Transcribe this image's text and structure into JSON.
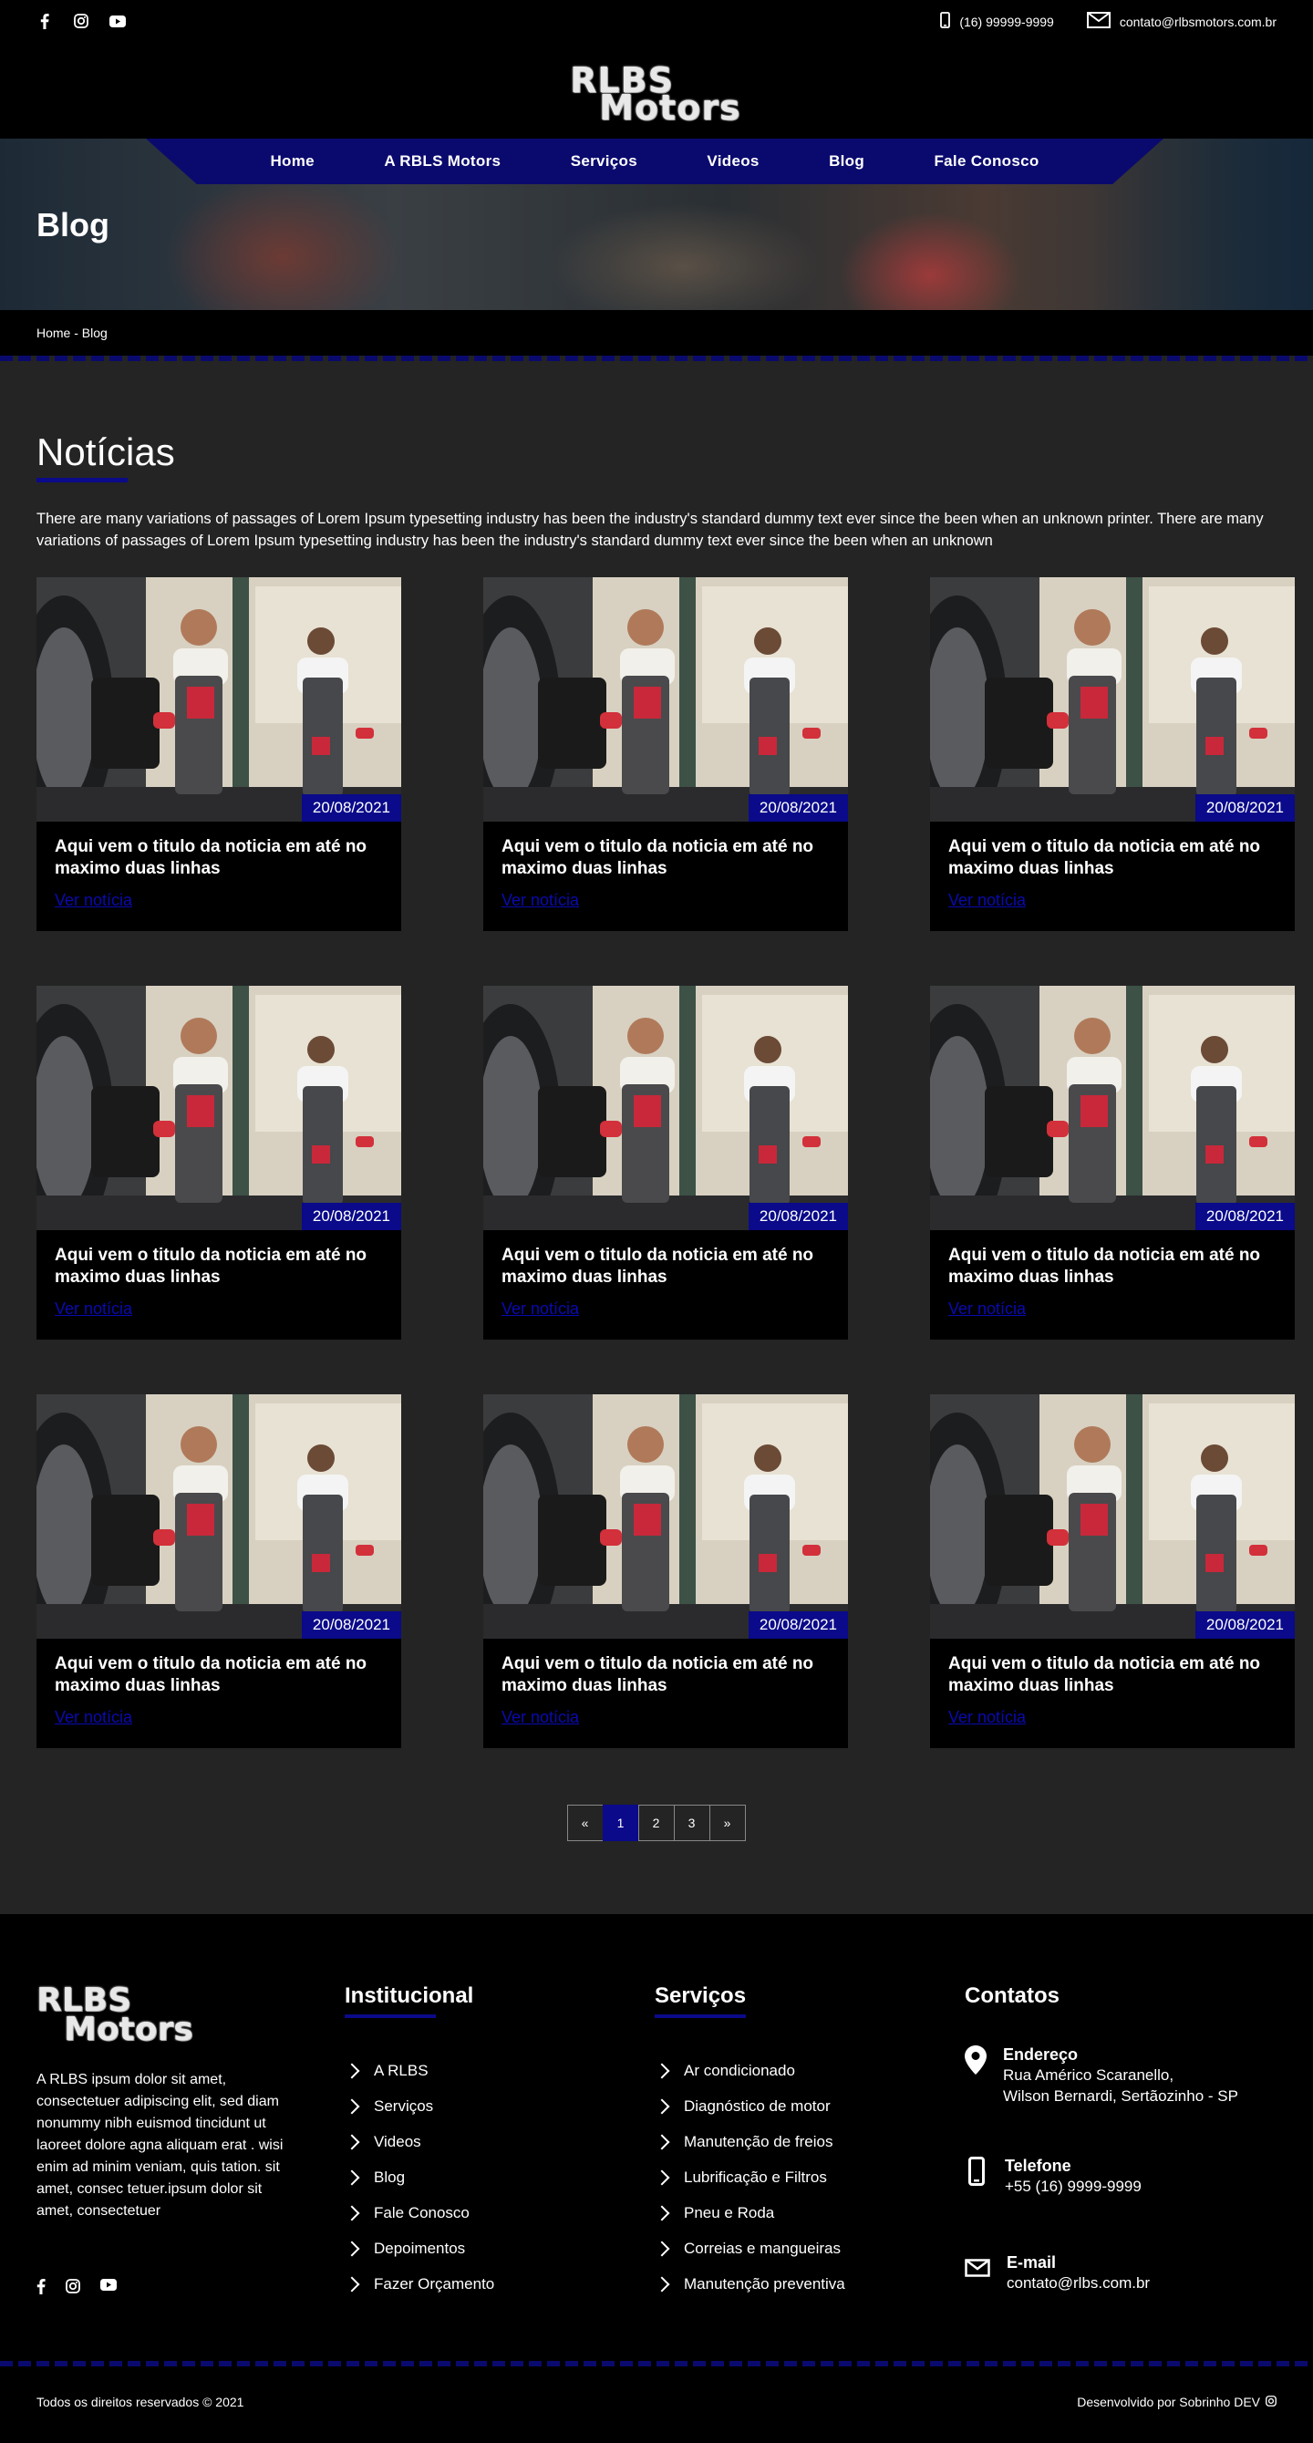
{
  "topbar": {
    "phone": "(16) 99999-9999",
    "email": "contato@rlbsmotors.com.br",
    "social": [
      "facebook-icon",
      "instagram-icon",
      "youtube-icon"
    ]
  },
  "logo": {
    "line1": "RLBS",
    "line2": "Motors"
  },
  "nav": [
    "Home",
    "A  RBLS  Motors",
    "Serviços",
    "Videos",
    "Blog",
    "Fale Conosco"
  ],
  "hero": {
    "title": "Blog"
  },
  "breadcrumb": "Home - Blog",
  "main": {
    "heading": "Notícias",
    "intro": "There are many variations of passages of Lorem Ipsum typesetting industry has been the industry's standard dummy text ever since the been when an unknown printer. There are many variations of passages of Lorem Ipsum typesetting industry has been the industry's standard dummy text ever since the been when an unknown"
  },
  "cards": [
    {
      "date": "20/08/2021",
      "title": "Aqui vem o titulo da noticia em até no maximo duas linhas",
      "link": "Ver notícia"
    },
    {
      "date": "20/08/2021",
      "title": "Aqui vem o titulo da noticia em até no maximo duas linhas",
      "link": "Ver notícia"
    },
    {
      "date": "20/08/2021",
      "title": "Aqui vem o titulo da noticia em até no maximo duas linhas",
      "link": "Ver notícia"
    },
    {
      "date": "20/08/2021",
      "title": "Aqui vem o titulo da noticia em até no maximo duas linhas",
      "link": "Ver notícia"
    },
    {
      "date": "20/08/2021",
      "title": "Aqui vem o titulo da noticia em até no maximo duas linhas",
      "link": "Ver notícia"
    },
    {
      "date": "20/08/2021",
      "title": "Aqui vem o titulo da noticia em até no maximo duas linhas",
      "link": "Ver notícia"
    },
    {
      "date": "20/08/2021",
      "title": "Aqui vem o titulo da noticia em até no maximo duas linhas",
      "link": "Ver notícia"
    },
    {
      "date": "20/08/2021",
      "title": "Aqui vem o titulo da noticia em até no maximo duas linhas",
      "link": "Ver notícia"
    },
    {
      "date": "20/08/2021",
      "title": "Aqui vem o titulo da noticia em até no maximo duas linhas",
      "link": "Ver notícia"
    }
  ],
  "pagination": {
    "prev": "«",
    "pages": [
      "1",
      "2",
      "3"
    ],
    "next": "»",
    "active": "1"
  },
  "footer": {
    "logo": {
      "line1": "RLBS",
      "line2": "Motors"
    },
    "about": "A RLBS ipsum dolor sit amet, consectetuer adipiscing elit, sed diam nonummy nibh euismod tincidunt ut laoreet dolore agna aliquam erat . wisi enim ad minim veniam, quis tation. sit amet, consec tetuer.ipsum dolor sit amet, consectetuer",
    "institucional": {
      "title": "Institucional",
      "items": [
        "A RLBS",
        "Serviços",
        "Videos",
        "Blog",
        "Fale Conosco",
        "Depoimentos",
        "Fazer Orçamento"
      ]
    },
    "servicos": {
      "title": "Serviços",
      "items": [
        "Ar condicionado",
        "Diagnóstico de motor",
        "Manutenção de freios",
        "Lubrificação e Filtros",
        "Pneu e Roda",
        "Correias e mangueiras",
        "Manutenção preventiva"
      ]
    },
    "contatos": {
      "title": "Contatos",
      "address_label": "Endereço",
      "address_line1": "Rua Américo Scaranello,",
      "address_line2": "Wilson Bernardi, Sertãozinho - SP",
      "phone_label": "Telefone",
      "phone": "+55 (16) 9999-9999",
      "email_label": "E-mail",
      "email": "contato@rlbs.com.br"
    },
    "copyright": "Todos os direitos reservados © 2021",
    "developer": "Desenvolvido por Sobrinho DEV"
  }
}
